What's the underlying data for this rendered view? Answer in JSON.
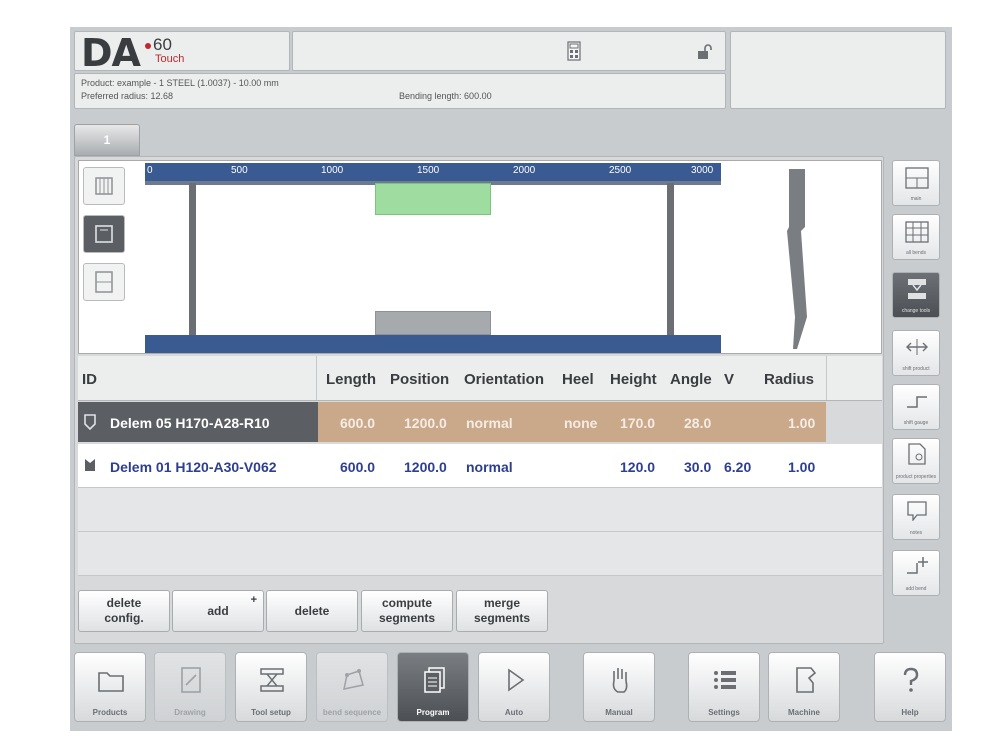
{
  "header": {
    "logo": {
      "brand": "DA",
      "model": "60",
      "edition": "Touch"
    },
    "product_line": "Product: example - 1 STEEL (1.0037) - 10.00 mm",
    "radius_line": "Preferred radius: 12.68",
    "bending_length": "Bending length: 600.00"
  },
  "tabs": [
    {
      "label": "1"
    }
  ],
  "ruler": {
    "ticks": [
      "0",
      "500",
      "1000",
      "1500",
      "2000",
      "2500",
      "3000"
    ]
  },
  "table": {
    "headers": [
      "ID",
      "Length",
      "Position",
      "Orientation",
      "Heel",
      "Height",
      "Angle",
      "V",
      "Radius"
    ],
    "rows": [
      {
        "id": "Delem 05 H170-A28-R10",
        "length": "600.0",
        "position": "1200.0",
        "orientation": "normal",
        "heel": "none",
        "height": "170.0",
        "angle": "28.0",
        "v": "",
        "radius": "1.00"
      },
      {
        "id": "Delem 01 H120-A30-V062",
        "length": "600.0",
        "position": "1200.0",
        "orientation": "normal",
        "heel": "",
        "height": "120.0",
        "angle": "30.0",
        "v": "6.20",
        "radius": "1.00"
      }
    ]
  },
  "actions": {
    "delete_config": [
      "delete",
      "config."
    ],
    "add": "add",
    "add_sup": "+",
    "delete": "delete",
    "compute": [
      "compute",
      "segments"
    ],
    "merge": [
      "merge",
      "segments"
    ]
  },
  "side_buttons": [
    {
      "label": "main",
      "icon": "layout-icon"
    },
    {
      "label": "all bends",
      "icon": "grid-icon"
    },
    {
      "label": "change tools",
      "icon": "tool-change-icon"
    },
    {
      "label": "shift product",
      "icon": "shift-icon"
    },
    {
      "label": "shift gauge",
      "icon": "step-icon"
    },
    {
      "label": "product properties",
      "icon": "document-icon"
    },
    {
      "label": "notes",
      "icon": "note-icon"
    },
    {
      "label": "add bend",
      "icon": "add-bend-icon"
    }
  ],
  "nav": [
    {
      "label": "Products",
      "icon": "folder-icon"
    },
    {
      "label": "Drawing",
      "icon": "pencil-icon"
    },
    {
      "label": "Tool setup",
      "icon": "tool-setup-icon"
    },
    {
      "label": "bend sequence",
      "icon": "sequence-icon"
    },
    {
      "label": "Program",
      "icon": "pages-icon"
    },
    {
      "label": "Auto",
      "icon": "play-icon"
    },
    {
      "label": "Manual",
      "icon": "hand-icon"
    },
    {
      "label": "Settings",
      "icon": "list-icon"
    },
    {
      "label": "Machine",
      "icon": "machine-icon"
    },
    {
      "label": "Help",
      "icon": "question-icon"
    }
  ],
  "colors": {
    "accent_blue": "#3a5a92",
    "selected_row": "#c9a98a",
    "text_blue": "#2d3f8f",
    "logo_red": "#c0282d"
  }
}
